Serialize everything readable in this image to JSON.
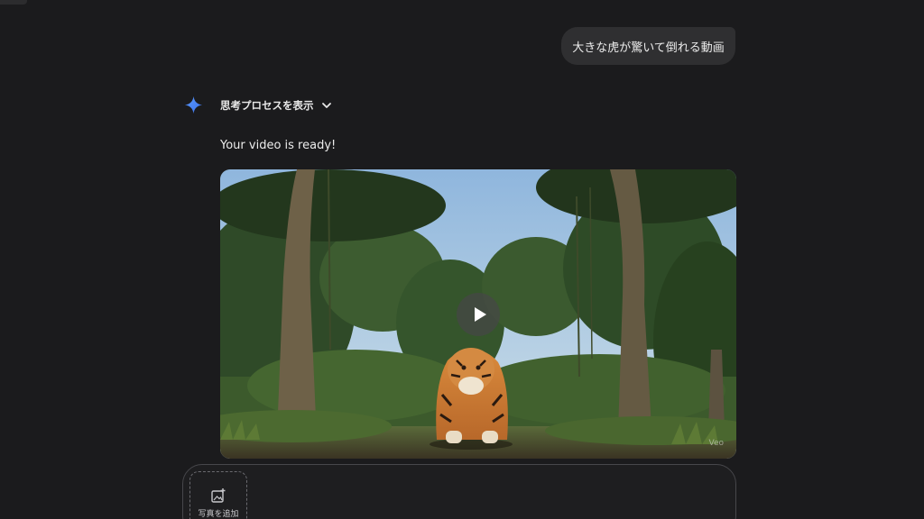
{
  "conversation": {
    "user_prompt": "大きな虎が驚いて倒れる動画",
    "thinking_label": "思考プロセスを表示",
    "reply_text": "Your video is ready!"
  },
  "video": {
    "watermark": "Veo"
  },
  "composer": {
    "add_photo_label": "写真を追加"
  },
  "icons": {
    "assistant": "gemini-sparkle-icon",
    "thinking": "chevron-down-icon",
    "video": "play-icon",
    "composer": "add-image-icon"
  },
  "colors": {
    "background": "#1b1b1d",
    "bubble": "#2f2f31",
    "sparkle_accent": "#4f8df7"
  }
}
